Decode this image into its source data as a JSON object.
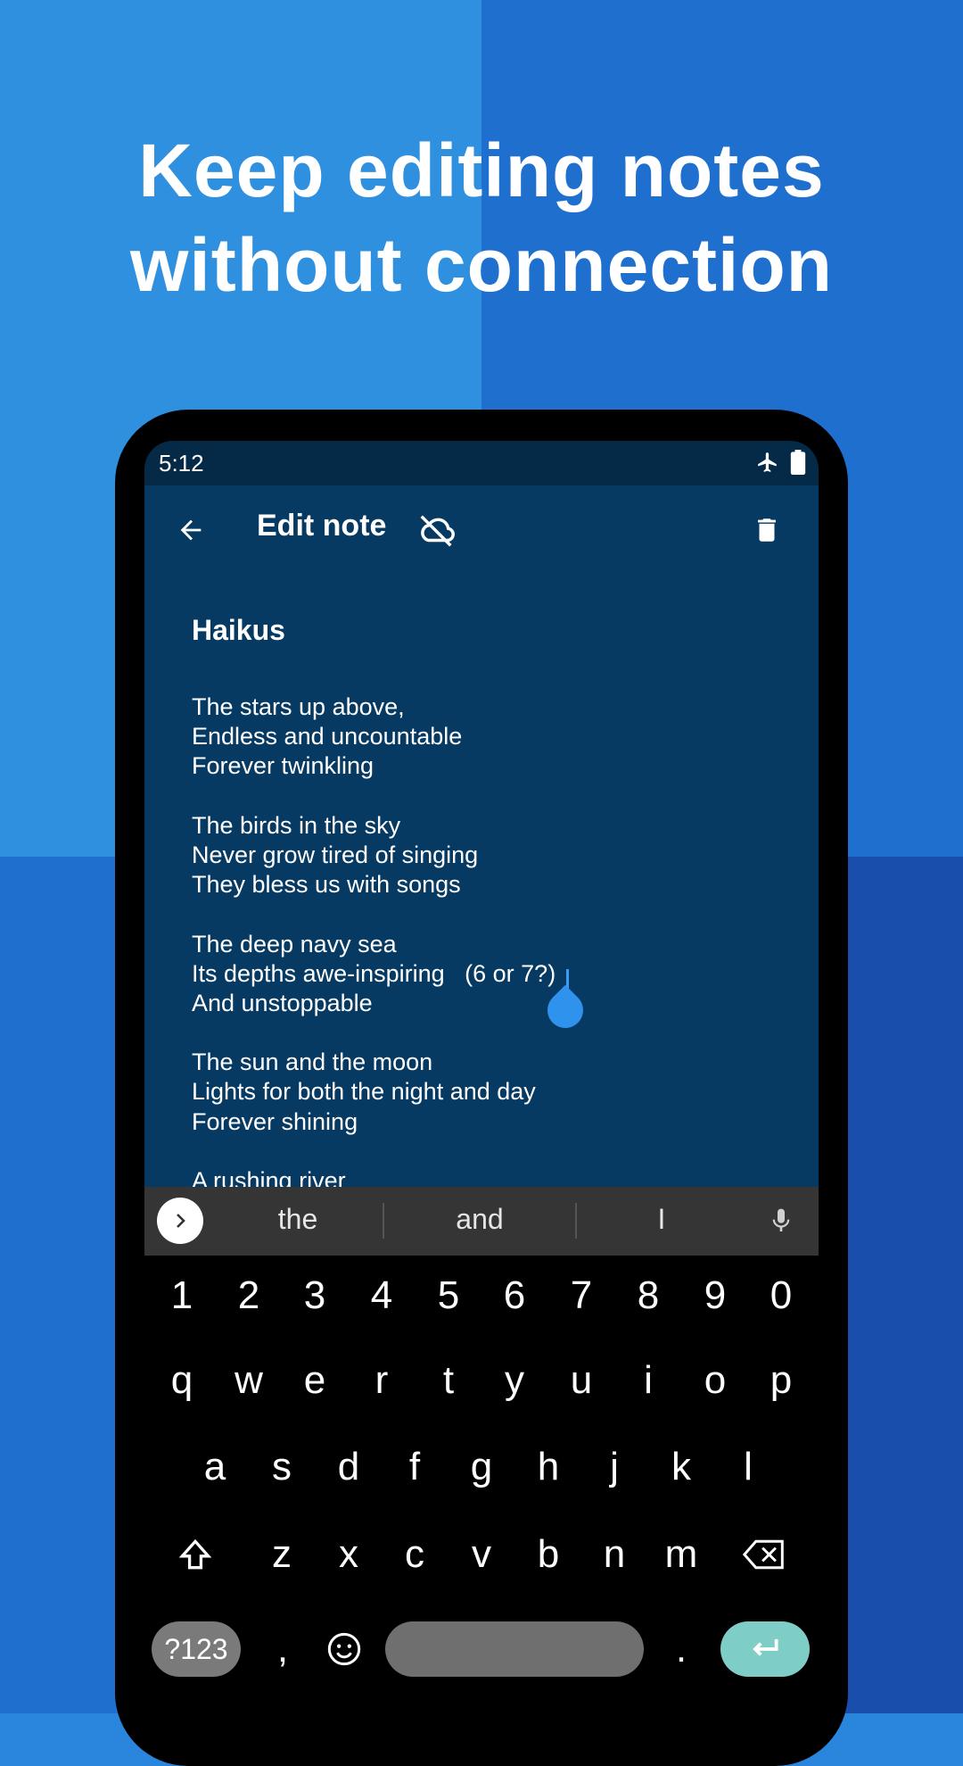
{
  "headline": {
    "line1": "Keep editing notes",
    "line2": "without connection"
  },
  "status_bar": {
    "time": "5:12",
    "icons": [
      "airplane-icon",
      "battery-icon"
    ]
  },
  "app_bar": {
    "title": "Edit note",
    "icons": [
      "back-arrow-icon",
      "cloud-off-icon",
      "delete-icon"
    ]
  },
  "note": {
    "title": "Haikus",
    "lines": [
      "The stars up above,",
      "Endless and uncountable",
      "Forever twinkling",
      "",
      "The birds in the sky",
      "Never grow tired of singing",
      "They bless us with songs",
      "",
      "The deep navy sea",
      "Its depths awe-inspiring   (6 or 7?)",
      "And unstoppable",
      "",
      "The sun and the moon",
      "Lights for both the night and day",
      "Forever shining",
      "",
      "A rushing river"
    ]
  },
  "suggestions": [
    "the",
    "and",
    "I"
  ],
  "keyboard": {
    "numbers": [
      "1",
      "2",
      "3",
      "4",
      "5",
      "6",
      "7",
      "8",
      "9",
      "0"
    ],
    "row1": [
      "q",
      "w",
      "e",
      "r",
      "t",
      "y",
      "u",
      "i",
      "o",
      "p"
    ],
    "row2": [
      "a",
      "s",
      "d",
      "f",
      "g",
      "h",
      "j",
      "k",
      "l"
    ],
    "row3": [
      "z",
      "x",
      "c",
      "v",
      "b",
      "n",
      "m"
    ],
    "symbols_label": "?123",
    "comma": ",",
    "period": "."
  },
  "colors": {
    "note_background": "#063a62",
    "status_background": "#052a48",
    "accent": "#2f93ee",
    "enter_key": "#7ecdc6"
  }
}
